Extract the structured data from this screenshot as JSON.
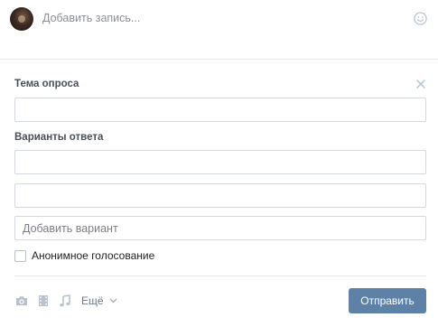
{
  "composer": {
    "placeholder": "Добавить запись..."
  },
  "poll": {
    "topic_label": "Тема опроса",
    "topic_value": "",
    "options_label": "Варианты ответа",
    "options": [
      "",
      ""
    ],
    "add_option_placeholder": "Добавить вариант",
    "anonymous_label": "Анонимное голосование",
    "anonymous_checked": false
  },
  "toolbar": {
    "icons": [
      "camera-icon",
      "video-icon",
      "music-icon"
    ],
    "more_label": "Ещё",
    "submit_label": "Отправить"
  },
  "colors": {
    "accent": "#5e81a8",
    "icon": "#b8c1cc",
    "border": "#d3d9de"
  }
}
